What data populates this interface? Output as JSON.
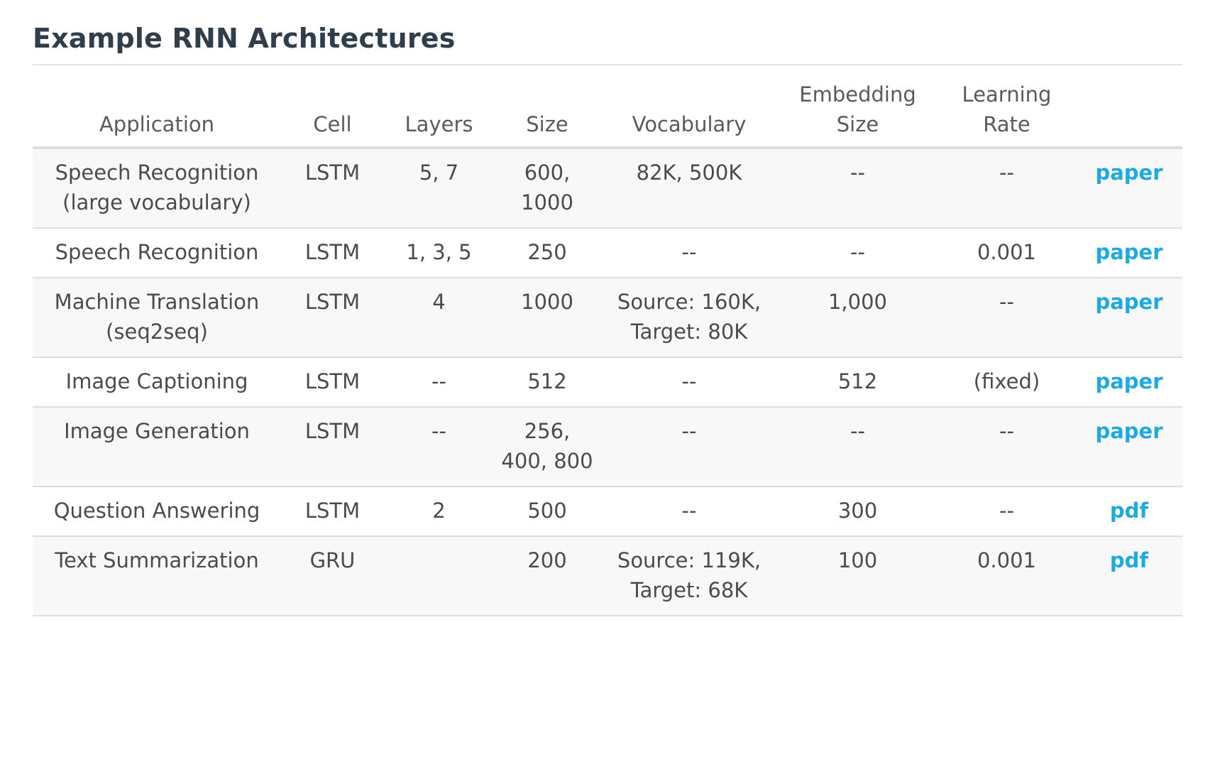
{
  "title": "Example RNN Architectures",
  "columns": [
    {
      "key": "application",
      "label": "Application"
    },
    {
      "key": "cell",
      "label": "Cell"
    },
    {
      "key": "layers",
      "label": "Layers"
    },
    {
      "key": "size",
      "label": "Size"
    },
    {
      "key": "vocabulary",
      "label": "Vocabulary"
    },
    {
      "key": "embedding_size",
      "label": "Embedding Size"
    },
    {
      "key": "learning_rate",
      "label": "Learning Rate"
    },
    {
      "key": "reference",
      "label": ""
    }
  ],
  "rows": [
    {
      "application": "Speech Recognition (large vocabulary)",
      "cell": "LSTM",
      "layers": "5, 7",
      "size": "600, 1000",
      "vocabulary": "82K, 500K",
      "embedding_size": "--",
      "learning_rate": "--",
      "reference": "paper"
    },
    {
      "application": "Speech Recognition",
      "cell": "LSTM",
      "layers": "1, 3, 5",
      "size": "250",
      "vocabulary": "--",
      "embedding_size": "--",
      "learning_rate": "0.001",
      "reference": "paper"
    },
    {
      "application": "Machine Translation (seq2seq)",
      "cell": "LSTM",
      "layers": "4",
      "size": "1000",
      "vocabulary": "Source: 160K, Target: 80K",
      "embedding_size": "1,000",
      "learning_rate": "--",
      "reference": "paper"
    },
    {
      "application": "Image Captioning",
      "cell": "LSTM",
      "layers": "--",
      "size": "512",
      "vocabulary": "--",
      "embedding_size": "512",
      "learning_rate": "(fixed)",
      "reference": "paper"
    },
    {
      "application": "Image Generation",
      "cell": "LSTM",
      "layers": "--",
      "size": "256, 400, 800",
      "vocabulary": "--",
      "embedding_size": "--",
      "learning_rate": "--",
      "reference": "paper"
    },
    {
      "application": "Question Answering",
      "cell": "LSTM",
      "layers": "2",
      "size": "500",
      "vocabulary": "--",
      "embedding_size": "300",
      "learning_rate": "--",
      "reference": "pdf"
    },
    {
      "application": "Text Summarization",
      "cell": "GRU",
      "layers": "",
      "size": "200",
      "vocabulary": "Source: 119K, Target: 68K",
      "embedding_size": "100",
      "learning_rate": "0.001",
      "reference": "pdf"
    }
  ],
  "colors": {
    "title": "#2f3e4a",
    "text": "#4b4b4b",
    "link": "#1faadf",
    "row_stripe": "#f8f8f8",
    "divider": "#dedede"
  }
}
